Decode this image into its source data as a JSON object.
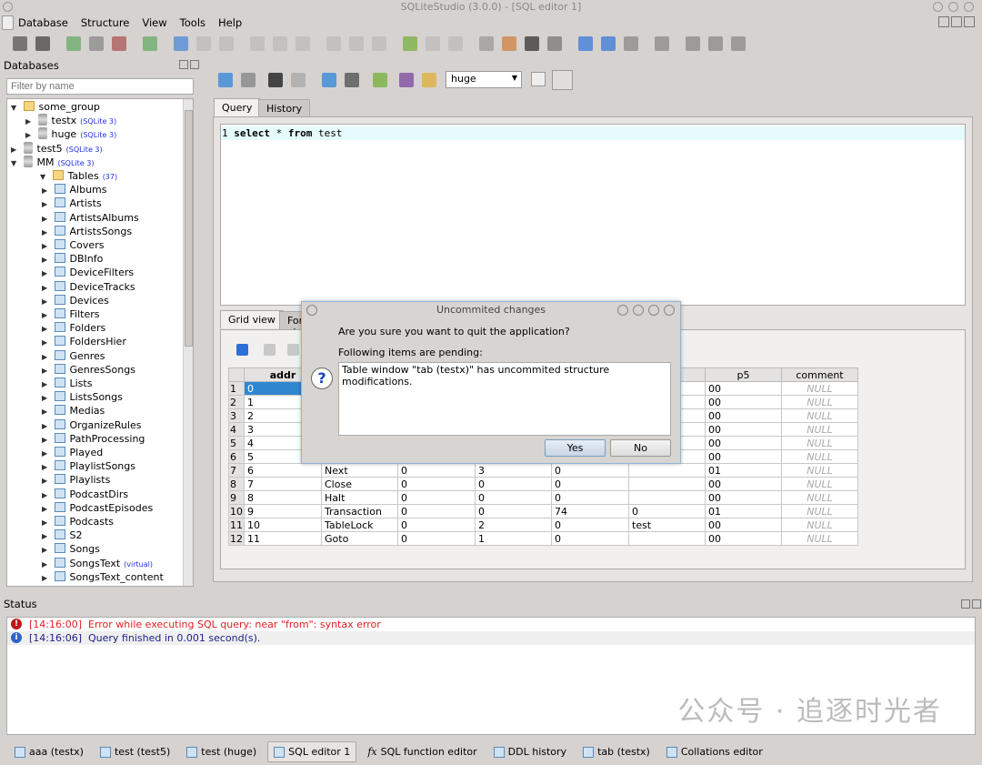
{
  "window": {
    "title": "SQLiteStudio (3.0.0) - [SQL editor 1]"
  },
  "menu": [
    "Database",
    "Structure",
    "View",
    "Tools",
    "Help"
  ],
  "databases_panel": {
    "title": "Databases",
    "filter_placeholder": "Filter by name",
    "tree": [
      {
        "label": "some_group",
        "level": 0,
        "kind": "group",
        "expanded": true
      },
      {
        "label": "testx",
        "tag": "(SQLite 3)",
        "level": 1,
        "kind": "db"
      },
      {
        "label": "huge",
        "tag": "(SQLite 3)",
        "level": 1,
        "kind": "db"
      },
      {
        "label": "test5",
        "tag": "(SQLite 3)",
        "level": 0,
        "kind": "db"
      },
      {
        "label": "MM",
        "tag": "(SQLite 3)",
        "level": 0,
        "kind": "db",
        "expanded": true
      },
      {
        "label": "Tables",
        "tag": "(37)",
        "level": 1,
        "kind": "folder",
        "expanded": true
      }
    ],
    "tables": [
      "Albums",
      "Artists",
      "ArtistsAlbums",
      "ArtistsSongs",
      "Covers",
      "DBInfo",
      "DeviceFilters",
      "DeviceTracks",
      "Devices",
      "Filters",
      "Folders",
      "FoldersHier",
      "Genres",
      "GenresSongs",
      "Lists",
      "ListsSongs",
      "Medias",
      "OrganizeRules",
      "PathProcessing",
      "Played",
      "PlaylistSongs",
      "Playlists",
      "PodcastDirs",
      "PodcastEpisodes",
      "Podcasts",
      "S2",
      "Songs",
      "SongsText",
      "SongsText_content"
    ],
    "virtual_table": "SongsText",
    "virtual_tag": "(virtual)"
  },
  "editor": {
    "db_select": "huge",
    "tabs": [
      "Query",
      "History"
    ],
    "line_number": "1",
    "sql": {
      "kw1": "select",
      "mid": " * ",
      "kw2": "from",
      "rest": " test"
    },
    "result_tabs": [
      "Grid view",
      "Form view"
    ]
  },
  "grid": {
    "columns": [
      "addr",
      "",
      "",
      "",
      "",
      "",
      "p5",
      "comment"
    ],
    "rows": [
      [
        "1",
        "0",
        "",
        "",
        "",
        "",
        "",
        "00",
        "NULL"
      ],
      [
        "2",
        "1",
        "",
        "",
        "",
        "",
        "",
        "00",
        "NULL"
      ],
      [
        "3",
        "2",
        "",
        "",
        "",
        "",
        "",
        "00",
        "NULL"
      ],
      [
        "4",
        "3",
        "",
        "",
        "",
        "",
        "",
        "00",
        "NULL"
      ],
      [
        "5",
        "4",
        "",
        "",
        "",
        "",
        "",
        "00",
        "NULL"
      ],
      [
        "6",
        "5",
        "",
        "",
        "",
        "",
        "",
        "00",
        "NULL"
      ],
      [
        "7",
        "6",
        "Next",
        "0",
        "3",
        "0",
        "",
        "01",
        "NULL"
      ],
      [
        "8",
        "7",
        "Close",
        "0",
        "0",
        "0",
        "",
        "00",
        "NULL"
      ],
      [
        "9",
        "8",
        "Halt",
        "0",
        "0",
        "0",
        "",
        "00",
        "NULL"
      ],
      [
        "10",
        "9",
        "Transaction",
        "0",
        "0",
        "74",
        "0",
        "01",
        "NULL"
      ],
      [
        "11",
        "10",
        "TableLock",
        "0",
        "2",
        "0",
        "test",
        "00",
        "NULL"
      ],
      [
        "12",
        "11",
        "Goto",
        "0",
        "1",
        "0",
        "",
        "00",
        "NULL"
      ]
    ]
  },
  "dialog": {
    "title": "Uncommited changes",
    "question": "Are you sure you want to quit the application?",
    "pending_label": "Following items are pending:",
    "items": "Table window \"tab (testx)\" has uncommited structure modifications.",
    "yes": "Yes",
    "no": "No"
  },
  "status": {
    "title": "Status",
    "messages": [
      {
        "time": "[14:16:00]",
        "text": "Error while executing SQL query: near \"from\": syntax error",
        "type": "error",
        "color": "#e02020"
      },
      {
        "time": "[14:16:06]",
        "text": "Query finished in 0.001 second(s).",
        "type": "info",
        "color": "#20208a"
      }
    ]
  },
  "taskbar": [
    {
      "label": "aaa (testx)",
      "icon": "table-icon"
    },
    {
      "label": "test (test5)",
      "icon": "table-icon"
    },
    {
      "label": "test (huge)",
      "icon": "table-icon"
    },
    {
      "label": "SQL editor 1",
      "icon": "sql-editor-icon",
      "active": true
    },
    {
      "label": "SQL function editor",
      "icon": "fx-icon"
    },
    {
      "label": "DDL history",
      "icon": "ddl-history-icon"
    },
    {
      "label": "tab (testx)",
      "icon": "table-icon"
    },
    {
      "label": "Collations editor",
      "icon": "collations-icon"
    }
  ],
  "watermark": "公众号 · 追逐时光者"
}
